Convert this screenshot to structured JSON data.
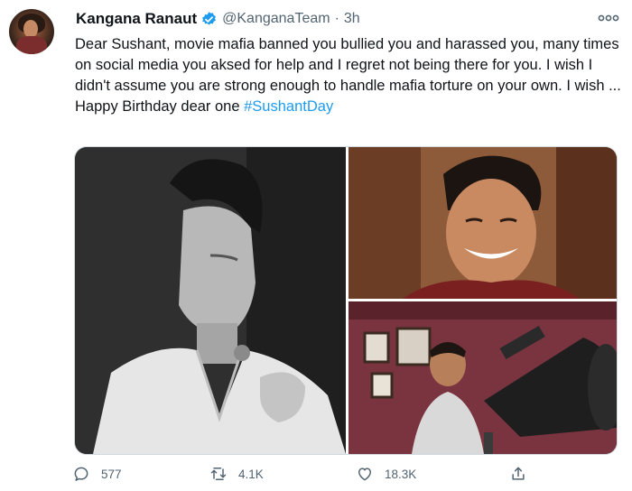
{
  "tweet": {
    "author_name": "Kangana Ranaut",
    "handle": "@KanganaTeam",
    "separator": "·",
    "time": "3h",
    "text_main": "Dear Sushant, movie mafia banned you bullied you and harassed you, many times on social media you aksed for help and I regret not being there for you. I wish I didn't assume you are strong enough to handle mafia torture on your own. I wish ...",
    "text_line2_prefix": "Happy Birthday dear one ",
    "hashtag": "#SushantDay",
    "link_color": "#1d9bf0",
    "verified_color": "#1d9bf0"
  },
  "media": {
    "images": [
      {
        "name": "black-and-white-portrait"
      },
      {
        "name": "smiling-portrait"
      },
      {
        "name": "telescope-photo"
      }
    ]
  },
  "actions": {
    "replies": "577",
    "retweets": "4.1K",
    "likes": "18.3K"
  },
  "icons": [
    "more-icon",
    "verified-icon",
    "reply-icon",
    "retweet-icon",
    "like-icon",
    "share-icon"
  ]
}
